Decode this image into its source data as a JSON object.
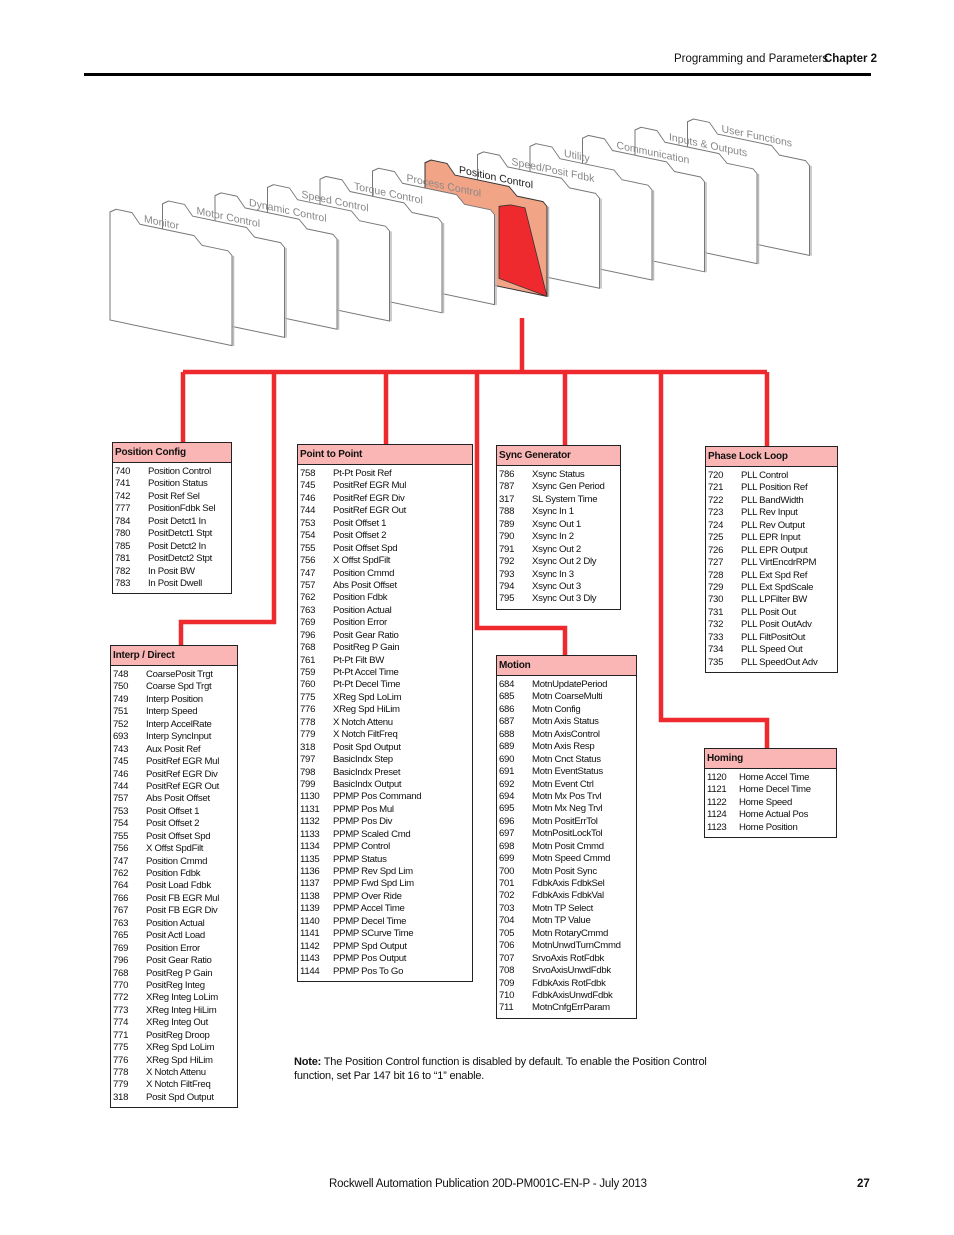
{
  "header": {
    "section": "Programming and Parameters",
    "chapter": "Chapter 2"
  },
  "folders": [
    {
      "label": "Monitor",
      "selected": false
    },
    {
      "label": "Motor Control",
      "selected": false
    },
    {
      "label": "Dynamic Control",
      "selected": false
    },
    {
      "label": "Speed Control",
      "selected": false
    },
    {
      "label": "Torque Control",
      "selected": false
    },
    {
      "label": "Process Control",
      "selected": false
    },
    {
      "label": "Position Control",
      "selected": true
    },
    {
      "label": "Speed/Posit Fdbk",
      "selected": false
    },
    {
      "label": "Utility",
      "selected": false
    },
    {
      "label": "Communication",
      "selected": false
    },
    {
      "label": "Inputs & Outputs",
      "selected": false
    },
    {
      "label": "User Functions",
      "selected": false
    }
  ],
  "colors": {
    "connector": "#ee2a2e",
    "box_header": "#f9b6b4",
    "selected_folder": "#f2a487",
    "selected_folder_inner": "#ee2a2e"
  },
  "groups": {
    "position_config": {
      "title": "Position Config",
      "params": [
        {
          "num": "740",
          "name": "Position Control"
        },
        {
          "num": "741",
          "name": "Position Status"
        },
        {
          "num": "742",
          "name": "Posit Ref Sel"
        },
        {
          "num": "777",
          "name": "PositionFdbk Sel"
        },
        {
          "num": "784",
          "name": "Posit Detct1 In"
        },
        {
          "num": "780",
          "name": "PositDetct1 Stpt"
        },
        {
          "num": "785",
          "name": "Posit Detct2 In"
        },
        {
          "num": "781",
          "name": "PositDetct2 Stpt"
        },
        {
          "num": "782",
          "name": "In Posit BW"
        },
        {
          "num": "783",
          "name": "In Posit Dwell"
        }
      ]
    },
    "interp_direct": {
      "title": "Interp / Direct",
      "params": [
        {
          "num": "748",
          "name": "CoarsePosit Trgt"
        },
        {
          "num": "750",
          "name": "Coarse Spd Trgt"
        },
        {
          "num": "749",
          "name": "Interp Position"
        },
        {
          "num": "751",
          "name": "Interp Speed"
        },
        {
          "num": "752",
          "name": "Interp AccelRate"
        },
        {
          "num": "693",
          "name": "Interp SyncInput"
        },
        {
          "num": "743",
          "name": "Aux Posit Ref"
        },
        {
          "num": "745",
          "name": "PositRef EGR Mul"
        },
        {
          "num": "746",
          "name": "PositRef EGR Div"
        },
        {
          "num": "744",
          "name": "PositRef EGR Out"
        },
        {
          "num": "757",
          "name": "Abs Posit Offset"
        },
        {
          "num": "753",
          "name": "Posit Offset 1"
        },
        {
          "num": "754",
          "name": "Posit Offset 2"
        },
        {
          "num": "755",
          "name": "Posit Offset Spd"
        },
        {
          "num": "756",
          "name": "X Offst SpdFilt"
        },
        {
          "num": "747",
          "name": "Position Cmmd"
        },
        {
          "num": "762",
          "name": "Position Fdbk"
        },
        {
          "num": "764",
          "name": "Posit Load Fdbk"
        },
        {
          "num": "766",
          "name": "Posit FB EGR Mul"
        },
        {
          "num": "767",
          "name": "Posit FB EGR Div"
        },
        {
          "num": "763",
          "name": "Position Actual"
        },
        {
          "num": "765",
          "name": "Posit Actl Load"
        },
        {
          "num": "769",
          "name": "Position Error"
        },
        {
          "num": "796",
          "name": "Posit Gear Ratio"
        },
        {
          "num": "768",
          "name": "PositReg P Gain"
        },
        {
          "num": "770",
          "name": "PositReg Integ"
        },
        {
          "num": "772",
          "name": "XReg Integ LoLim"
        },
        {
          "num": "773",
          "name": "XReg Integ HiLim"
        },
        {
          "num": "774",
          "name": "XReg Integ Out"
        },
        {
          "num": "771",
          "name": "PositReg Droop"
        },
        {
          "num": "775",
          "name": "XReg Spd LoLim"
        },
        {
          "num": "776",
          "name": "XReg Spd HiLim"
        },
        {
          "num": "778",
          "name": "X Notch Attenu"
        },
        {
          "num": "779",
          "name": "X Notch FiltFreq"
        },
        {
          "num": "318",
          "name": "Posit Spd Output"
        }
      ]
    },
    "point_to_point": {
      "title": "Point to Point",
      "params": [
        {
          "num": "758",
          "name": "Pt-Pt Posit Ref"
        },
        {
          "num": "745",
          "name": "PositRef EGR Mul"
        },
        {
          "num": "746",
          "name": "PositRef EGR Div"
        },
        {
          "num": "744",
          "name": "PositRef EGR Out"
        },
        {
          "num": "753",
          "name": "Posit Offset 1"
        },
        {
          "num": "754",
          "name": "Posit Offset 2"
        },
        {
          "num": "755",
          "name": "Posit Offset Spd"
        },
        {
          "num": "756",
          "name": "X Offst SpdFilt"
        },
        {
          "num": "747",
          "name": "Position Cmmd"
        },
        {
          "num": "757",
          "name": "Abs Posit Offset"
        },
        {
          "num": "762",
          "name": "Position Fdbk"
        },
        {
          "num": "763",
          "name": "Position Actual"
        },
        {
          "num": "769",
          "name": "Position Error"
        },
        {
          "num": "796",
          "name": "Posit Gear Ratio"
        },
        {
          "num": "768",
          "name": "PositReg P Gain"
        },
        {
          "num": "761",
          "name": "Pt-Pt Filt BW"
        },
        {
          "num": "759",
          "name": "Pt-Pt Accel Time"
        },
        {
          "num": "760",
          "name": "Pt-Pt Decel Time"
        },
        {
          "num": "775",
          "name": "XReg Spd LoLim"
        },
        {
          "num": "776",
          "name": "XReg Spd HiLim"
        },
        {
          "num": "778",
          "name": "X Notch Attenu"
        },
        {
          "num": "779",
          "name": "X Notch FiltFreq"
        },
        {
          "num": "318",
          "name": "Posit Spd Output"
        },
        {
          "num": "797",
          "name": "BasicIndx Step"
        },
        {
          "num": "798",
          "name": "BasicIndx Preset"
        },
        {
          "num": "799",
          "name": "BasicIndx Output"
        },
        {
          "num": "1130",
          "name": "PPMP Pos Command"
        },
        {
          "num": "1131",
          "name": "PPMP Pos Mul"
        },
        {
          "num": "1132",
          "name": "PPMP Pos Div"
        },
        {
          "num": "1133",
          "name": "PPMP Scaled Cmd"
        },
        {
          "num": "1134",
          "name": "PPMP Control"
        },
        {
          "num": "1135",
          "name": "PPMP Status"
        },
        {
          "num": "1136",
          "name": "PPMP Rev Spd Lim"
        },
        {
          "num": "1137",
          "name": "PPMP Fwd Spd Lim"
        },
        {
          "num": "1138",
          "name": "PPMP Over Ride"
        },
        {
          "num": "1139",
          "name": "PPMP Accel Time"
        },
        {
          "num": "1140",
          "name": "PPMP Decel Time"
        },
        {
          "num": "1141",
          "name": "PPMP SCurve Time"
        },
        {
          "num": "1142",
          "name": "PPMP Spd Output"
        },
        {
          "num": "1143",
          "name": "PPMP Pos Output"
        },
        {
          "num": "1144",
          "name": "PPMP Pos To Go"
        }
      ]
    },
    "sync_generator": {
      "title": "Sync Generator",
      "params": [
        {
          "num": "786",
          "name": "Xsync Status"
        },
        {
          "num": "787",
          "name": "Xsync Gen Period"
        },
        {
          "num": "317",
          "name": "SL System Time"
        },
        {
          "num": "788",
          "name": "Xsync In 1"
        },
        {
          "num": "789",
          "name": "Xsync Out 1"
        },
        {
          "num": "790",
          "name": "Xsync In 2"
        },
        {
          "num": "791",
          "name": "Xsync Out 2"
        },
        {
          "num": "792",
          "name": "Xsync Out 2 Dly"
        },
        {
          "num": "793",
          "name": "Xsync In 3"
        },
        {
          "num": "794",
          "name": "Xsync Out 3"
        },
        {
          "num": "795",
          "name": "Xsync Out 3 Dly"
        }
      ]
    },
    "motion": {
      "title": "Motion",
      "params": [
        {
          "num": "684",
          "name": "MotnUpdatePeriod"
        },
        {
          "num": "685",
          "name": "Motn CoarseMulti"
        },
        {
          "num": "686",
          "name": "Motn Config"
        },
        {
          "num": "687",
          "name": "Motn Axis Status"
        },
        {
          "num": "688",
          "name": "Motn AxisControl"
        },
        {
          "num": "689",
          "name": "Motn Axis Resp"
        },
        {
          "num": "690",
          "name": "Motn Cnct Status"
        },
        {
          "num": "691",
          "name": "Motn EventStatus"
        },
        {
          "num": "692",
          "name": "Motn Event Ctrl"
        },
        {
          "num": "694",
          "name": "Motn Mx Pos Trvl"
        },
        {
          "num": "695",
          "name": "Motn Mx Neg Trvl"
        },
        {
          "num": "696",
          "name": "Motn PositErrTol"
        },
        {
          "num": "697",
          "name": "MotnPositLockTol"
        },
        {
          "num": "698",
          "name": "Motn Posit Cmmd"
        },
        {
          "num": "699",
          "name": "Motn Speed Cmmd"
        },
        {
          "num": "700",
          "name": "Motn Posit Sync"
        },
        {
          "num": "701",
          "name": "FdbkAxis FdbkSel"
        },
        {
          "num": "702",
          "name": "FdbkAxis FdbkVal"
        },
        {
          "num": "703",
          "name": "Motn TP Select"
        },
        {
          "num": "704",
          "name": "Motn TP Value"
        },
        {
          "num": "705",
          "name": "Motn RotaryCmmd"
        },
        {
          "num": "706",
          "name": "MotnUnwdTurnCmmd"
        },
        {
          "num": "707",
          "name": "SrvoAxis RotFdbk"
        },
        {
          "num": "708",
          "name": "SrvoAxisUnwdFdbk"
        },
        {
          "num": "709",
          "name": "FdbkAxis RotFdbk"
        },
        {
          "num": "710",
          "name": "FdbkAxisUnwdFdbk"
        },
        {
          "num": "711",
          "name": "MotnCnfgErrParam"
        }
      ]
    },
    "phase_lock_loop": {
      "title": "Phase Lock Loop",
      "params": [
        {
          "num": "720",
          "name": "PLL Control"
        },
        {
          "num": "721",
          "name": "PLL Position Ref"
        },
        {
          "num": "722",
          "name": "PLL BandWidth"
        },
        {
          "num": "723",
          "name": "PLL Rev Input"
        },
        {
          "num": "724",
          "name": "PLL Rev Output"
        },
        {
          "num": "725",
          "name": "PLL EPR Input"
        },
        {
          "num": "726",
          "name": "PLL EPR Output"
        },
        {
          "num": "727",
          "name": "PLL VirtEncdrRPM"
        },
        {
          "num": "728",
          "name": "PLL Ext Spd Ref"
        },
        {
          "num": "729",
          "name": "PLL Ext SpdScale"
        },
        {
          "num": "730",
          "name": "PLL LPFilter BW"
        },
        {
          "num": "731",
          "name": "PLL Posit Out"
        },
        {
          "num": "732",
          "name": "PLL Posit OutAdv"
        },
        {
          "num": "733",
          "name": "PLL FiltPositOut"
        },
        {
          "num": "734",
          "name": "PLL Speed Out"
        },
        {
          "num": "735",
          "name": "PLL SpeedOut Adv"
        }
      ]
    },
    "homing": {
      "title": "Homing",
      "params": [
        {
          "num": "1120",
          "name": "Home Accel Time"
        },
        {
          "num": "1121",
          "name": "Home Decel Time"
        },
        {
          "num": "1122",
          "name": "Home Speed"
        },
        {
          "num": "1124",
          "name": "Home Actual Pos"
        },
        {
          "num": "1123",
          "name": "Home Position"
        }
      ]
    }
  },
  "note": {
    "label": "Note:",
    "text": " The Position Control function is disabled by default. To enable the Position Control function, set Par 147 bit 16 to “1” enable."
  },
  "footer": {
    "publication": "Rockwell Automation Publication 20D-PM001C-EN-P - July 2013",
    "page": "27"
  }
}
